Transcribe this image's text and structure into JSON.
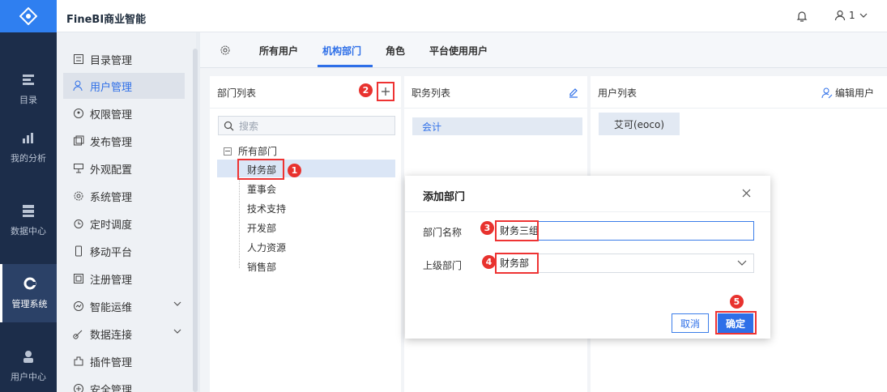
{
  "app": {
    "title": "FineBI商业智能",
    "user": "1"
  },
  "rail": {
    "items": [
      {
        "label": "目录",
        "icon": "catalog-icon"
      },
      {
        "label": "我的分析",
        "icon": "analysis-icon"
      },
      {
        "label": "数据中心",
        "icon": "data-center-icon"
      },
      {
        "label": "管理系统",
        "icon": "gear-icon",
        "active": true
      },
      {
        "label": "用户中心",
        "icon": "user-center-icon"
      }
    ]
  },
  "menu": {
    "items": [
      {
        "label": "目录管理",
        "icon": "list-icon"
      },
      {
        "label": "用户管理",
        "icon": "user-icon",
        "active": true
      },
      {
        "label": "权限管理",
        "icon": "permission-icon"
      },
      {
        "label": "发布管理",
        "icon": "publish-icon"
      },
      {
        "label": "外观配置",
        "icon": "appearance-icon"
      },
      {
        "label": "系统管理",
        "icon": "gear-icon"
      },
      {
        "label": "定时调度",
        "icon": "clock-icon"
      },
      {
        "label": "移动平台",
        "icon": "mobile-icon"
      },
      {
        "label": "注册管理",
        "icon": "register-icon"
      },
      {
        "label": "智能运维",
        "icon": "ops-icon"
      },
      {
        "label": "数据连接",
        "icon": "link-icon"
      },
      {
        "label": "插件管理",
        "icon": "plugin-icon"
      },
      {
        "label": "安全管理",
        "icon": "security-icon"
      }
    ]
  },
  "tabs": [
    "所有用户",
    "机构部门",
    "角色",
    "平台使用用户"
  ],
  "dept_panel": {
    "title": "部门列表",
    "search_placeholder": "搜索",
    "root": "所有部门",
    "items": [
      "财务部",
      "董事会",
      "技术支持",
      "开发部",
      "人力资源",
      "销售部"
    ]
  },
  "position_panel": {
    "title": "职务列表",
    "items": [
      "会计"
    ]
  },
  "user_panel": {
    "title": "用户列表",
    "edit": "编辑用户",
    "items": [
      "艾可(eoco)"
    ]
  },
  "dialog": {
    "title": "添加部门",
    "name_label": "部门名称",
    "name_value": "财务三组",
    "parent_label": "上级部门",
    "parent_value": "财务部",
    "cancel": "取消",
    "confirm": "确定"
  },
  "badges": [
    "1",
    "2",
    "3",
    "4",
    "5"
  ],
  "colors": {
    "accent": "#2e6fe8",
    "rail": "#1c2d4a",
    "badge": "#e8322e"
  }
}
